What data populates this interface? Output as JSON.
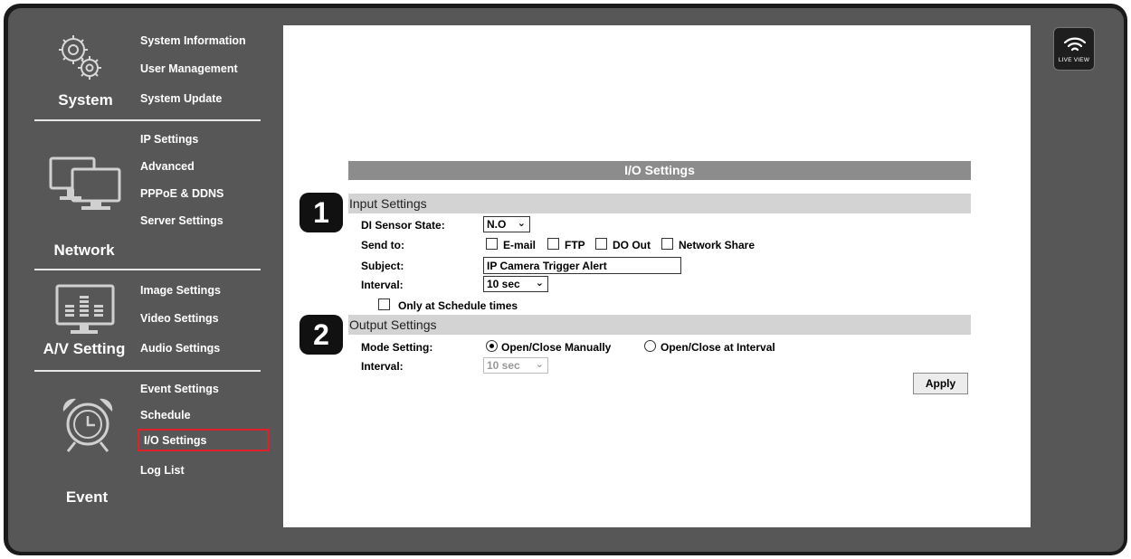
{
  "nav": {
    "system": {
      "label": "System",
      "icon": "gears-icon",
      "items": [
        "System Information",
        "User Management",
        "System Update"
      ]
    },
    "network": {
      "label": "Network",
      "icon": "monitors-icon",
      "items": [
        "IP Settings",
        "Advanced",
        "PPPoE & DDNS",
        "Server Settings"
      ]
    },
    "av": {
      "label": "A/V Setting",
      "icon": "equalizer-monitor-icon",
      "items": [
        "Image Settings",
        "Video Settings",
        "Audio Settings"
      ]
    },
    "event": {
      "label": "Event",
      "icon": "alarm-clock-icon",
      "items": [
        "Event Settings",
        "Schedule",
        "I/O Settings",
        "Log List"
      ]
    },
    "active_item": "I/O Settings"
  },
  "live_view": {
    "label": "LIVE VIEW",
    "icon": "wifi-signal-icon"
  },
  "io": {
    "title": "I/O Settings",
    "badges": [
      "1",
      "2"
    ],
    "input": {
      "header": "Input Settings",
      "di_label": "DI Sensor State:",
      "di_value": "N.O",
      "send_label": "Send to:",
      "send_options": [
        "E-mail",
        "FTP",
        "DO Out",
        "Network Share"
      ],
      "subject_label": "Subject:",
      "subject_value": "IP Camera Trigger Alert",
      "interval_label": "Interval:",
      "interval_value": "10 sec",
      "schedule_label": "Only at Schedule times"
    },
    "output": {
      "header": "Output Settings",
      "mode_label": "Mode Setting:",
      "mode_options": [
        "Open/Close Manually",
        "Open/Close at Interval"
      ],
      "mode_selected": "Open/Close Manually",
      "interval_label": "Interval:",
      "interval_value": "10 sec"
    },
    "apply_label": "Apply"
  },
  "colors": {
    "panel": "#575757",
    "frame": "#1a1a1a",
    "active_border": "#e0202a",
    "title_bar": "#8c8c8c",
    "section_bar": "#d3d3d3"
  }
}
